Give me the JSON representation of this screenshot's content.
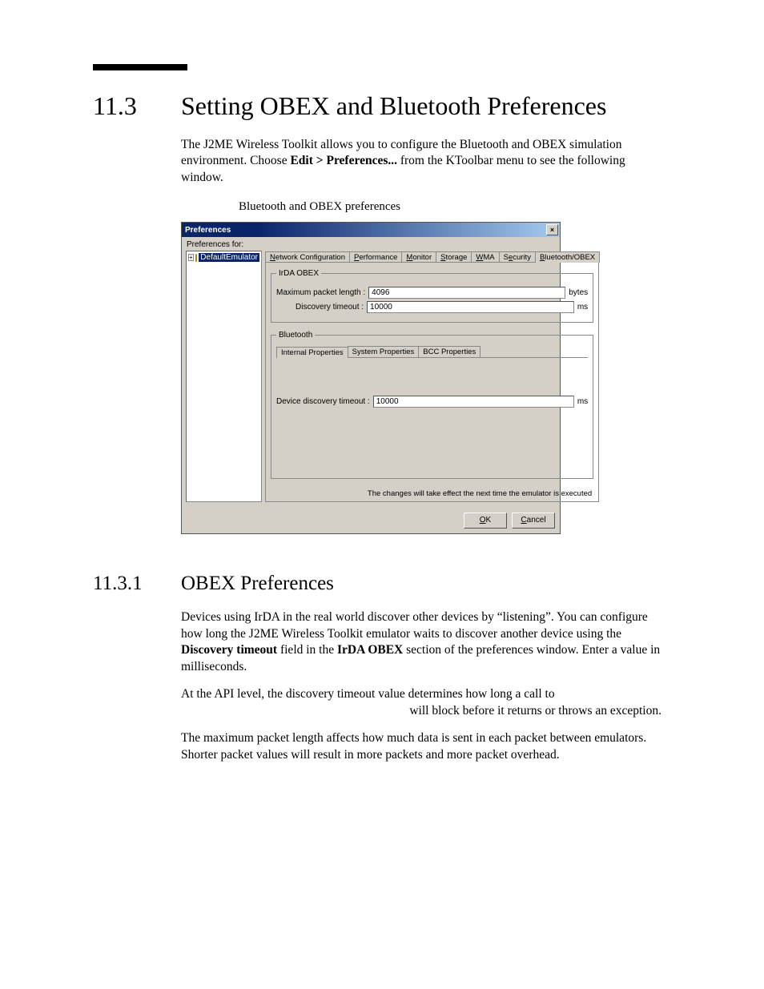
{
  "section": {
    "number": "11.3",
    "title": "Setting OBEX and Bluetooth Preferences",
    "para1_a": "The J2ME Wireless Toolkit allows you to configure the Bluetooth and OBEX simulation environment. Choose ",
    "para1_bold": "Edit > Preferences...",
    "para1_b": " from the KToolbar menu to see the following window.",
    "figure_caption": "Bluetooth and OBEX preferences"
  },
  "subsection": {
    "number": "11.3.1",
    "title": "OBEX Preferences",
    "p1_a": "Devices using IrDA in the real world discover other devices by “listening”. You can configure how long the J2ME Wireless Toolkit emulator waits to discover another device using the ",
    "p1_b1": "Discovery timeout",
    "p1_mid": " field in the ",
    "p1_b2": "IrDA OBEX",
    "p1_c": " section of the preferences window. Enter a value in milliseconds.",
    "p2_a": "At the API level, the discovery timeout value determines how long a call to ",
    "p2_b": " will block before it returns or throws an exception.",
    "p3": "The maximum packet length affects how much data is sent in each packet between emulators. Shorter packet values will result in more packets and more packet overhead."
  },
  "window": {
    "title": "Preferences",
    "prefs_for": "Preferences for:",
    "tree_item": "DefaultEmulator",
    "tabs": [
      "Network Configuration",
      "Performance",
      "Monitor",
      "Storage",
      "WMA",
      "Security",
      "Bluetooth/OBEX"
    ],
    "irda": {
      "legend": "IrDA OBEX",
      "max_label": "Maximum packet length :",
      "max_value": "4096",
      "max_unit": "bytes",
      "disc_label": "Discovery timeout :",
      "disc_value": "10000",
      "disc_unit": "ms"
    },
    "bt": {
      "legend": "Bluetooth",
      "subtabs": [
        "Internal Properties",
        "System Properties",
        "BCC Properties"
      ],
      "dev_label": "Device discovery timeout :",
      "dev_value": "10000",
      "dev_unit": "ms"
    },
    "note": "The changes will take effect the next time the emulator is executed",
    "ok": "OK",
    "cancel": "Cancel"
  }
}
